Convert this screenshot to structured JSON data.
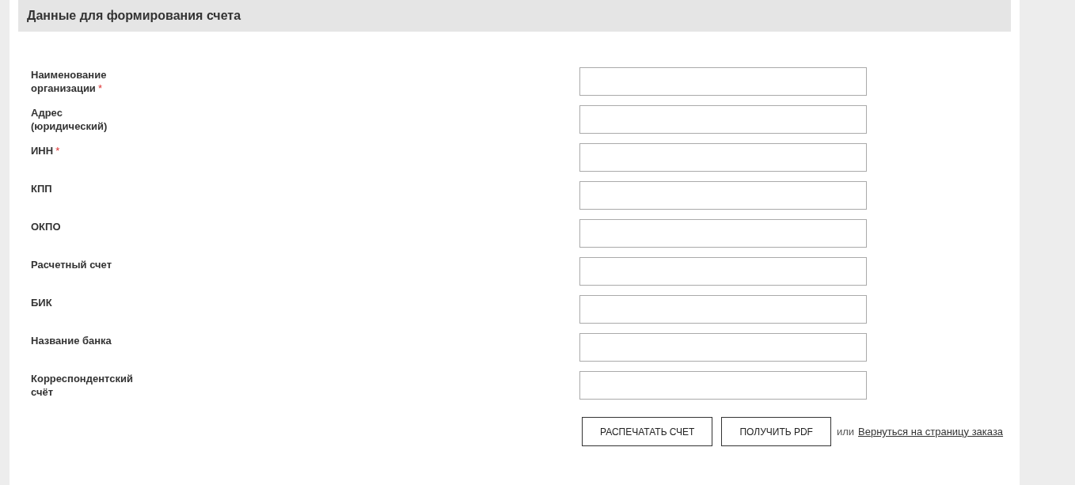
{
  "section": {
    "title": "Данные для формирования счета"
  },
  "fields": [
    {
      "label": "Наименование организации",
      "required_mark": "*"
    },
    {
      "label": "Адрес (юридический)"
    },
    {
      "label": "ИНН",
      "required_mark": "*"
    },
    {
      "label": "КПП"
    },
    {
      "label": "ОКПО"
    },
    {
      "label": "Расчетный счет"
    },
    {
      "label": "БИК"
    },
    {
      "label": "Название банка"
    },
    {
      "label": "Корреспондентский счёт"
    }
  ],
  "buttons": [
    "РАСПЕЧАТАТЬ СЧЕТ",
    "ПОЛУЧИТЬ PDF"
  ],
  "separator": "или",
  "back_link": "Вернуться на страницу заказа"
}
